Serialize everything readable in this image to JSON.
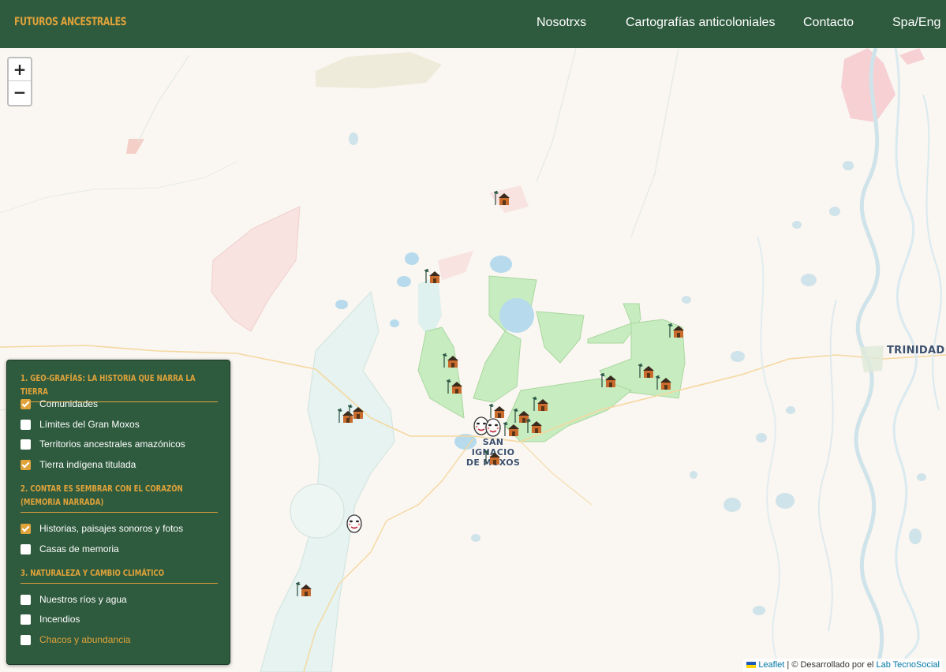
{
  "navbar": {
    "brand": "Futuros Ancestrales",
    "links": [
      {
        "label": "Nosotrxs"
      },
      {
        "label": "Cartografías anticoloniales"
      },
      {
        "label": "Contacto"
      },
      {
        "label": "Spa/Eng"
      }
    ]
  },
  "map": {
    "zoom_in": "+",
    "zoom_out": "−",
    "cities": [
      {
        "name": "SAN IGNACIO",
        "name2": "DE MOXOS"
      },
      {
        "name": "TRINIDAD"
      }
    ],
    "colors": {
      "indigenous_land": "#c7ecc0",
      "indigenous_land_border": "#a9d79f",
      "moxos_territory": "#d9efec",
      "reserve_pink": "#f6d7d7",
      "water": "#b7dbec",
      "road": "#f5d8a0",
      "river_channel": "#cfe3ea"
    },
    "marker_types": [
      "community-house-icon",
      "memory-mask-icon"
    ]
  },
  "panel": {
    "sections": [
      {
        "title": "1. Geo-grafías: la historia que narra la tierra",
        "options": [
          {
            "label": "Comunidades",
            "checked": true
          },
          {
            "label": "Límites del Gran Moxos",
            "checked": false
          },
          {
            "label": "Territorios ancestrales amazónicos",
            "checked": false
          },
          {
            "label": "Tierra indígena titulada",
            "checked": true
          }
        ]
      },
      {
        "title": "2. Contar es sembrar con el corazón (memoria narrada)",
        "options": [
          {
            "label": "Historias, paisajes sonoros y fotos",
            "checked": true
          },
          {
            "label": "Casas de memoria",
            "checked": false
          }
        ]
      },
      {
        "title": "3. Naturaleza y cambio climático",
        "options": [
          {
            "label": "Nuestros ríos y agua",
            "checked": false
          },
          {
            "label": "Incendios",
            "checked": false
          },
          {
            "label": "Chacos y abundancia",
            "checked": false
          }
        ]
      }
    ]
  },
  "attribution": {
    "leaflet": "Leaflet",
    "separator": " | © Desarrollado por el ",
    "lab": "Lab TecnoSocial"
  }
}
